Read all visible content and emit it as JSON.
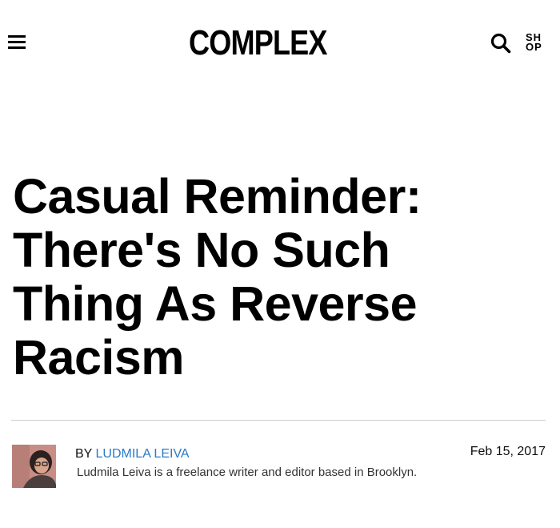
{
  "header": {
    "logo_text": "COMPLEX",
    "shop_label_top": "SH",
    "shop_label_bottom": "OP",
    "icons": {
      "menu": "hamburger-menu-icon",
      "search": "search-icon"
    }
  },
  "article": {
    "title_lines": [
      "Casual Reminder:",
      "There's No Such",
      "Thing As Reverse",
      "Racism"
    ],
    "byline_prefix": "BY",
    "author_name": "LUDMILA LEIVA",
    "author_bio": "Ludmila Leiva is a freelance writer and editor based in Brooklyn.",
    "date": "Feb 15, 2017"
  },
  "colors": {
    "link": "#2a7ac8",
    "divider": "#cfcfcf",
    "text": "#000000"
  }
}
